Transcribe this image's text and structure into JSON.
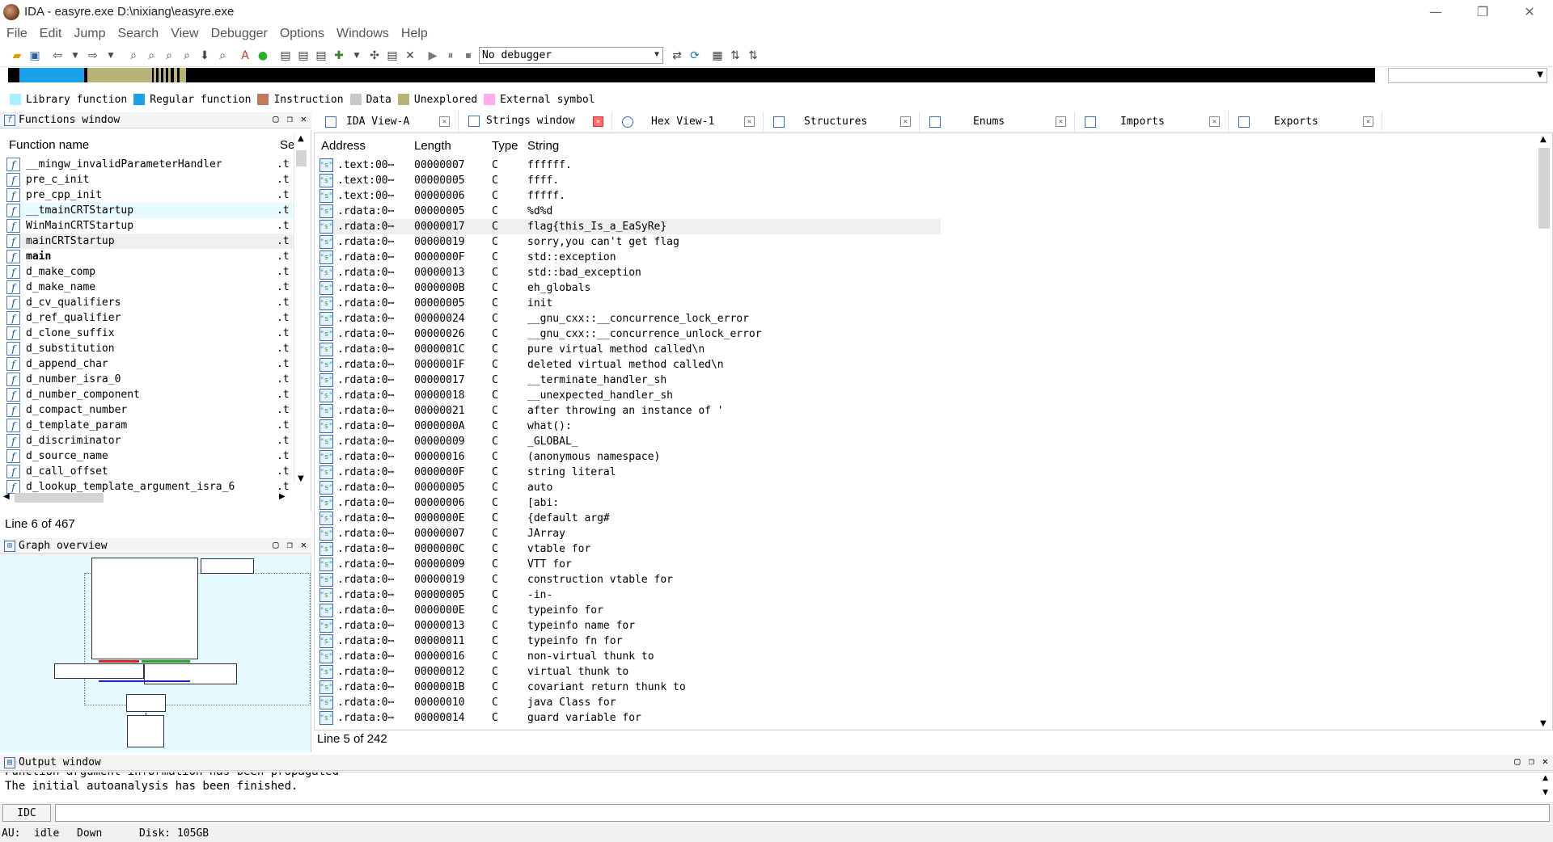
{
  "window": {
    "title": "IDA - easyre.exe D:\\nixiang\\easyre.exe",
    "minimize": "—",
    "restore": "❐",
    "close": "✕"
  },
  "menu": [
    "File",
    "Edit",
    "Jump",
    "Search",
    "View",
    "Debugger",
    "Options",
    "Windows",
    "Help"
  ],
  "toolbar": {
    "debugger": "No debugger"
  },
  "legend": [
    {
      "label": "Library function",
      "color": "#a8f0ff"
    },
    {
      "label": "Regular function",
      "color": "#1aa1ea"
    },
    {
      "label": "Instruction",
      "color": "#c07a5a"
    },
    {
      "label": "Data",
      "color": "#c8c8c8"
    },
    {
      "label": "Unexplored",
      "color": "#b8b478"
    },
    {
      "label": "External symbol",
      "color": "#ffadee"
    }
  ],
  "functions_window": {
    "title": "Functions window",
    "col_name": "Function name",
    "col_segment": "Se",
    "items": [
      {
        "name": "__mingw_invalidParameterHandler",
        "seg": ".t"
      },
      {
        "name": "pre_c_init",
        "seg": ".t"
      },
      {
        "name": "pre_cpp_init",
        "seg": ".t"
      },
      {
        "name": "__tmainCRTStartup",
        "seg": ".t"
      },
      {
        "name": "WinMainCRTStartup",
        "seg": ".t"
      },
      {
        "name": "mainCRTStartup",
        "seg": ".t"
      },
      {
        "name": "main",
        "seg": ".t"
      },
      {
        "name": "d_make_comp",
        "seg": ".t"
      },
      {
        "name": "d_make_name",
        "seg": ".t"
      },
      {
        "name": "d_cv_qualifiers",
        "seg": ".t"
      },
      {
        "name": "d_ref_qualifier",
        "seg": ".t"
      },
      {
        "name": "d_clone_suffix",
        "seg": ".t"
      },
      {
        "name": "d_substitution",
        "seg": ".t"
      },
      {
        "name": "d_append_char",
        "seg": ".t"
      },
      {
        "name": "d_number_isra_0",
        "seg": ".t"
      },
      {
        "name": "d_number_component",
        "seg": ".t"
      },
      {
        "name": "d_compact_number",
        "seg": ".t"
      },
      {
        "name": "d_template_param",
        "seg": ".t"
      },
      {
        "name": "d_discriminator",
        "seg": ".t"
      },
      {
        "name": "d_source_name",
        "seg": ".t"
      },
      {
        "name": "d_call_offset",
        "seg": ".t"
      },
      {
        "name": "d_lookup_template_argument_isra_6",
        "seg": ".t"
      }
    ],
    "status": "Line 6 of 467"
  },
  "graph_overview": {
    "title": "Graph overview"
  },
  "tabs": [
    {
      "label": "IDA View-A"
    },
    {
      "label": "Strings window"
    },
    {
      "label": "Hex View-1"
    },
    {
      "label": "Structures"
    },
    {
      "label": "Enums"
    },
    {
      "label": "Imports"
    },
    {
      "label": "Exports"
    }
  ],
  "strings_window": {
    "col_address": "Address",
    "col_length": "Length",
    "col_type": "Type",
    "col_string": "String",
    "rows": [
      {
        "addr": ".text:00⋯",
        "len": "00000007",
        "type": "C",
        "str": "ffffff."
      },
      {
        "addr": ".text:00⋯",
        "len": "00000005",
        "type": "C",
        "str": "ffff."
      },
      {
        "addr": ".text:00⋯",
        "len": "00000006",
        "type": "C",
        "str": "fffff."
      },
      {
        "addr": ".rdata:0⋯",
        "len": "00000005",
        "type": "C",
        "str": "%d%d"
      },
      {
        "addr": ".rdata:0⋯",
        "len": "00000017",
        "type": "C",
        "str": "flag{this_Is_a_EaSyRe}"
      },
      {
        "addr": ".rdata:0⋯",
        "len": "00000019",
        "type": "C",
        "str": "sorry,you can't get flag"
      },
      {
        "addr": ".rdata:0⋯",
        "len": "0000000F",
        "type": "C",
        "str": "std::exception"
      },
      {
        "addr": ".rdata:0⋯",
        "len": "00000013",
        "type": "C",
        "str": "std::bad_exception"
      },
      {
        "addr": ".rdata:0⋯",
        "len": "0000000B",
        "type": "C",
        "str": "eh_globals"
      },
      {
        "addr": ".rdata:0⋯",
        "len": "00000005",
        "type": "C",
        "str": "init"
      },
      {
        "addr": ".rdata:0⋯",
        "len": "00000024",
        "type": "C",
        "str": "__gnu_cxx::__concurrence_lock_error"
      },
      {
        "addr": ".rdata:0⋯",
        "len": "00000026",
        "type": "C",
        "str": "__gnu_cxx::__concurrence_unlock_error"
      },
      {
        "addr": ".rdata:0⋯",
        "len": "0000001C",
        "type": "C",
        "str": "pure virtual method called\\n"
      },
      {
        "addr": ".rdata:0⋯",
        "len": "0000001F",
        "type": "C",
        "str": "deleted virtual method called\\n"
      },
      {
        "addr": ".rdata:0⋯",
        "len": "00000017",
        "type": "C",
        "str": "__terminate_handler_sh"
      },
      {
        "addr": ".rdata:0⋯",
        "len": "00000018",
        "type": "C",
        "str": "__unexpected_handler_sh"
      },
      {
        "addr": ".rdata:0⋯",
        "len": "00000021",
        "type": "C",
        "str": " after throwing an instance of '"
      },
      {
        "addr": ".rdata:0⋯",
        "len": "0000000A",
        "type": "C",
        "str": "what():"
      },
      {
        "addr": ".rdata:0⋯",
        "len": "00000009",
        "type": "C",
        "str": "_GLOBAL_"
      },
      {
        "addr": ".rdata:0⋯",
        "len": "00000016",
        "type": "C",
        "str": "(anonymous namespace)"
      },
      {
        "addr": ".rdata:0⋯",
        "len": "0000000F",
        "type": "C",
        "str": "string literal"
      },
      {
        "addr": ".rdata:0⋯",
        "len": "00000005",
        "type": "C",
        "str": "auto"
      },
      {
        "addr": ".rdata:0⋯",
        "len": "00000006",
        "type": "C",
        "str": "[abi:"
      },
      {
        "addr": ".rdata:0⋯",
        "len": "0000000E",
        "type": "C",
        "str": "{default arg#"
      },
      {
        "addr": ".rdata:0⋯",
        "len": "00000007",
        "type": "C",
        "str": "JArray"
      },
      {
        "addr": ".rdata:0⋯",
        "len": "0000000C",
        "type": "C",
        "str": "vtable for"
      },
      {
        "addr": ".rdata:0⋯",
        "len": "00000009",
        "type": "C",
        "str": "VTT for"
      },
      {
        "addr": ".rdata:0⋯",
        "len": "00000019",
        "type": "C",
        "str": "construction vtable for"
      },
      {
        "addr": ".rdata:0⋯",
        "len": "00000005",
        "type": "C",
        "str": "-in-"
      },
      {
        "addr": ".rdata:0⋯",
        "len": "0000000E",
        "type": "C",
        "str": "typeinfo for"
      },
      {
        "addr": ".rdata:0⋯",
        "len": "00000013",
        "type": "C",
        "str": "typeinfo name for"
      },
      {
        "addr": ".rdata:0⋯",
        "len": "00000011",
        "type": "C",
        "str": "typeinfo fn for"
      },
      {
        "addr": ".rdata:0⋯",
        "len": "00000016",
        "type": "C",
        "str": "non-virtual thunk to"
      },
      {
        "addr": ".rdata:0⋯",
        "len": "00000012",
        "type": "C",
        "str": "virtual thunk to"
      },
      {
        "addr": ".rdata:0⋯",
        "len": "0000001B",
        "type": "C",
        "str": "covariant return thunk to"
      },
      {
        "addr": ".rdata:0⋯",
        "len": "00000010",
        "type": "C",
        "str": "java Class for"
      },
      {
        "addr": ".rdata:0⋯",
        "len": "00000014",
        "type": "C",
        "str": "guard variable for"
      }
    ],
    "status": "Line 5 of 242"
  },
  "output_window": {
    "title": "Output window",
    "lines": [
      "Function argument information has been propagated",
      "The initial autoanalysis has been finished."
    ]
  },
  "command": {
    "language": "IDC"
  },
  "statusbar": {
    "au": "AU:",
    "state": "idle",
    "direction": "Down",
    "disk": "Disk: 105GB"
  }
}
